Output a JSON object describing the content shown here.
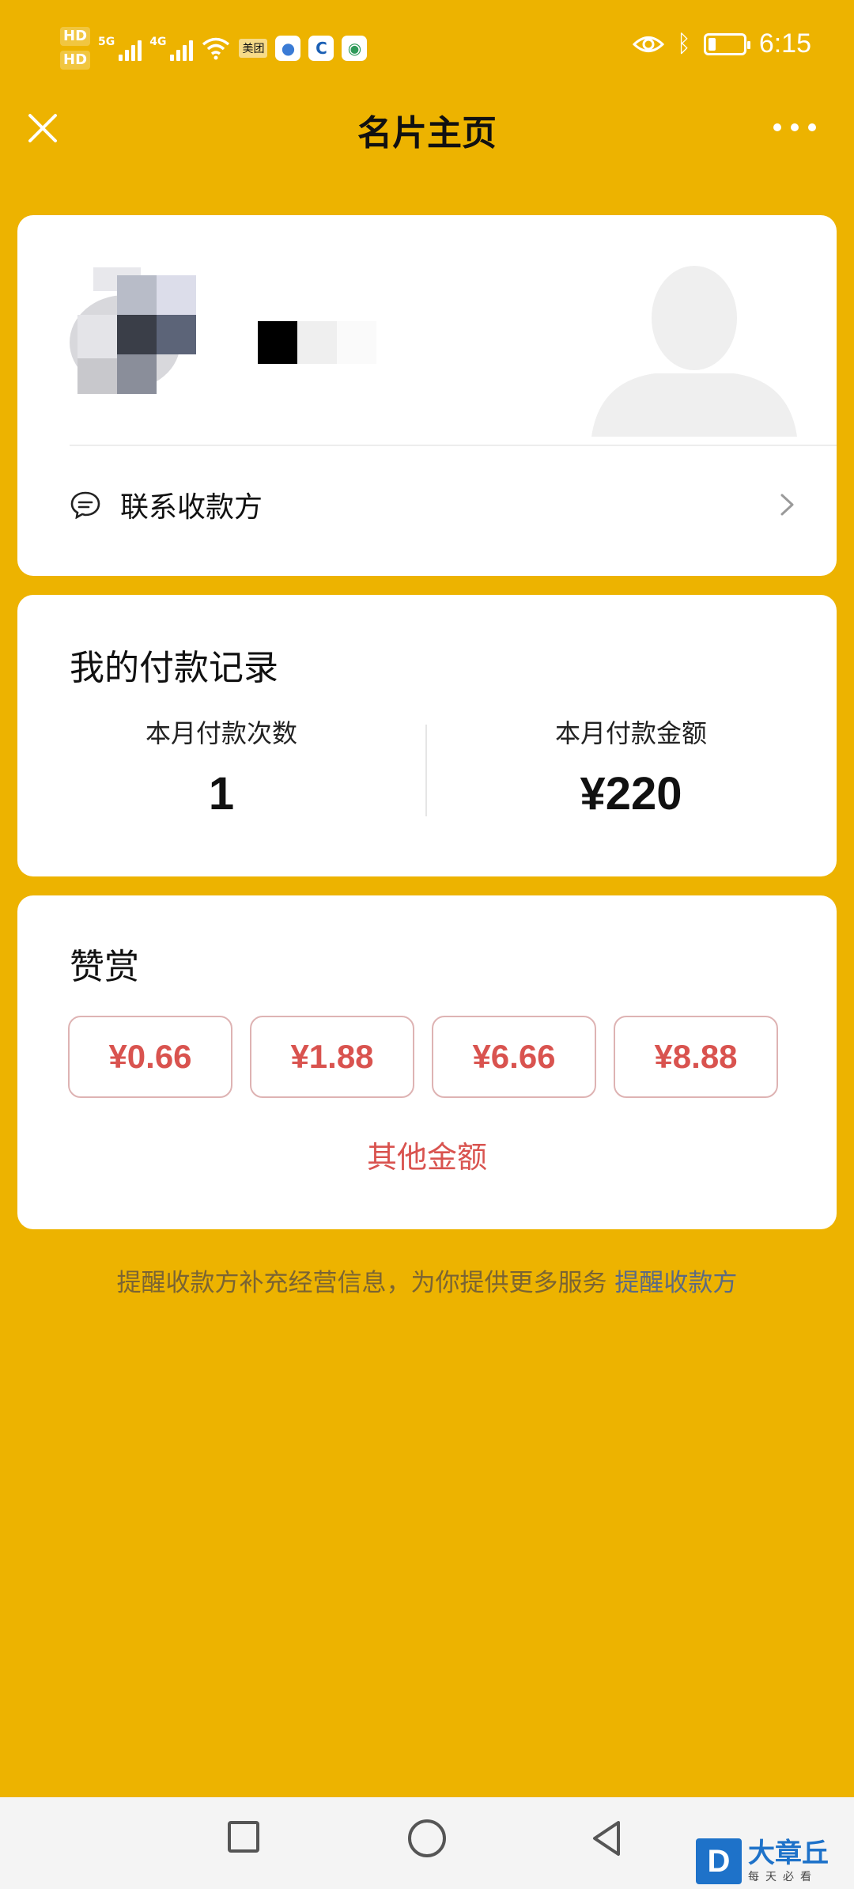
{
  "status_bar": {
    "hd1": "HD",
    "hd2": "HD",
    "net1": "5G",
    "net2": "4G",
    "meituan_tag": "美团",
    "time": "6:15",
    "battery_level": 0.22,
    "icons": [
      "signal-icon",
      "wifi-icon",
      "app-icon",
      "eye-icon",
      "bluetooth-icon",
      "battery-icon"
    ]
  },
  "nav": {
    "title": "名片主页"
  },
  "profile": {
    "contact_label": "联系收款方"
  },
  "payment_records": {
    "title": "我的付款记录",
    "count_label": "本月付款次数",
    "count_value": "1",
    "amount_label": "本月付款金额",
    "amount_value": "¥220"
  },
  "tip": {
    "title": "赞赏",
    "amounts": [
      "¥0.66",
      "¥1.88",
      "¥6.66",
      "¥8.88"
    ],
    "other_label": "其他金额"
  },
  "footer": {
    "note": "提醒收款方补充经营信息，为你提供更多服务",
    "link": "提醒收款方"
  },
  "watermark": {
    "logo": "D",
    "title": "大章丘",
    "subtitle": "每天必看"
  },
  "colors": {
    "background": "#EDB300",
    "accent_red": "#D9534F",
    "link": "#5B6A83"
  }
}
